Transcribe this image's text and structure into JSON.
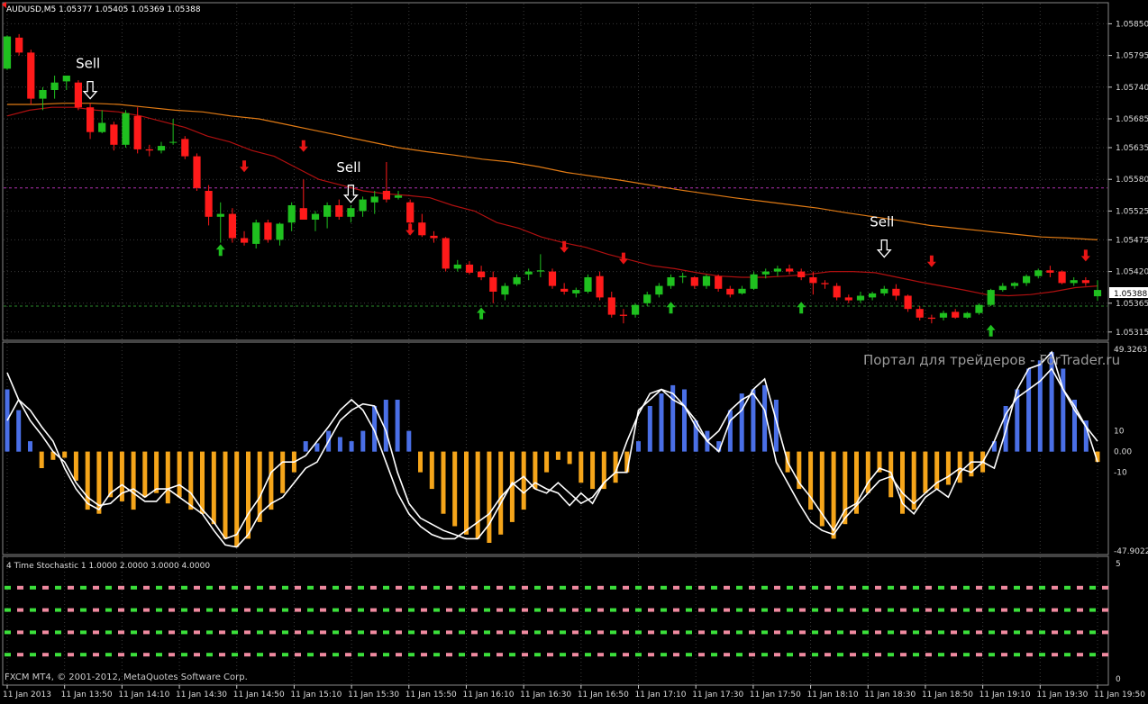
{
  "title": "AUDUSD,M5  1.05377 1.05405 1.05369 1.05388",
  "footer": "FXCM MT4, © 2001-2012, MetaQuotes Software Corp.",
  "watermark": "Портал для трейдеров - ForTrader.ru",
  "current_price_label": "1.05388",
  "signal_label": "Sell",
  "colors": {
    "background": "#000000",
    "grid": "#3a3a3a",
    "bull": "#1fc01f",
    "bear": "#ff1a1a",
    "ma_fast": "#b01010",
    "ma_slow": "#e07a14",
    "hist_pos": "#4a6fe6",
    "hist_neg": "#f5a51a",
    "osc_line": "#ffffff",
    "up_arrow": "#1fc01f",
    "down_arrow": "#e81515",
    "level_magenta": "#b030b0",
    "level_green": "#2a8a2a",
    "stoch_green": "#3be03b",
    "stoch_pink": "#f08aa0"
  },
  "x_labels": [
    "11 Jan 2013",
    "11 Jan 13:50",
    "11 Jan 14:10",
    "11 Jan 14:30",
    "11 Jan 14:50",
    "11 Jan 15:10",
    "11 Jan 15:30",
    "11 Jan 15:50",
    "11 Jan 16:10",
    "11 Jan 16:30",
    "11 Jan 16:50",
    "11 Jan 17:10",
    "11 Jan 17:30",
    "11 Jan 17:50",
    "11 Jan 18:10",
    "11 Jan 18:30",
    "11 Jan 18:50",
    "11 Jan 19:10",
    "11 Jan 19:30",
    "11 Jan 19:50"
  ],
  "chart_data": [
    {
      "type": "candlestick",
      "title": "AUDUSD,M5  1.05377 1.05405 1.05369 1.05388",
      "y_ticks": [
        "1.05850",
        "1.05795",
        "1.05740",
        "1.05685",
        "1.05635",
        "1.05580",
        "1.05525",
        "1.05475",
        "1.05420",
        "1.05365",
        "1.05315"
      ],
      "ylim": [
        1.0531,
        1.0586
      ],
      "candles": [
        {
          "o": 1.05772,
          "h": 1.0583,
          "l": 1.0577,
          "c": 1.05828
        },
        {
          "o": 1.05826,
          "h": 1.05832,
          "l": 1.05795,
          "c": 1.058
        },
        {
          "o": 1.058,
          "h": 1.05805,
          "l": 1.0571,
          "c": 1.0572
        },
        {
          "o": 1.0572,
          "h": 1.0574,
          "l": 1.057,
          "c": 1.05735
        },
        {
          "o": 1.05735,
          "h": 1.0576,
          "l": 1.0572,
          "c": 1.05748
        },
        {
          "o": 1.0575,
          "h": 1.0576,
          "l": 1.05735,
          "c": 1.0576
        },
        {
          "o": 1.05748,
          "h": 1.05752,
          "l": 1.057,
          "c": 1.05705
        },
        {
          "o": 1.05705,
          "h": 1.05712,
          "l": 1.0565,
          "c": 1.05662
        },
        {
          "o": 1.05662,
          "h": 1.057,
          "l": 1.0566,
          "c": 1.05678
        },
        {
          "o": 1.05675,
          "h": 1.0568,
          "l": 1.0563,
          "c": 1.0564
        },
        {
          "o": 1.0564,
          "h": 1.057,
          "l": 1.05635,
          "c": 1.05695
        },
        {
          "o": 1.0569,
          "h": 1.05705,
          "l": 1.05625,
          "c": 1.05632
        },
        {
          "o": 1.05632,
          "h": 1.0564,
          "l": 1.0562,
          "c": 1.0563
        },
        {
          "o": 1.0563,
          "h": 1.05645,
          "l": 1.05625,
          "c": 1.05638
        },
        {
          "o": 1.05645,
          "h": 1.05685,
          "l": 1.0564,
          "c": 1.05645
        },
        {
          "o": 1.0565,
          "h": 1.05655,
          "l": 1.05615,
          "c": 1.0562
        },
        {
          "o": 1.0562,
          "h": 1.05625,
          "l": 1.0556,
          "c": 1.05565
        },
        {
          "o": 1.0556,
          "h": 1.0557,
          "l": 1.055,
          "c": 1.05515
        },
        {
          "o": 1.05515,
          "h": 1.0554,
          "l": 1.0547,
          "c": 1.0552
        },
        {
          "o": 1.0552,
          "h": 1.0553,
          "l": 1.0547,
          "c": 1.05478
        },
        {
          "o": 1.05478,
          "h": 1.0549,
          "l": 1.05465,
          "c": 1.0547
        },
        {
          "o": 1.05468,
          "h": 1.0551,
          "l": 1.0546,
          "c": 1.05505
        },
        {
          "o": 1.05505,
          "h": 1.0551,
          "l": 1.0547,
          "c": 1.05475
        },
        {
          "o": 1.05475,
          "h": 1.05505,
          "l": 1.05465,
          "c": 1.05503
        },
        {
          "o": 1.05505,
          "h": 1.0554,
          "l": 1.0549,
          "c": 1.05535
        },
        {
          "o": 1.0553,
          "h": 1.0558,
          "l": 1.0552,
          "c": 1.0551
        },
        {
          "o": 1.0551,
          "h": 1.05525,
          "l": 1.0549,
          "c": 1.0552
        },
        {
          "o": 1.05515,
          "h": 1.0554,
          "l": 1.05495,
          "c": 1.05535
        },
        {
          "o": 1.05535,
          "h": 1.05545,
          "l": 1.0551,
          "c": 1.05515
        },
        {
          "o": 1.05515,
          "h": 1.05535,
          "l": 1.05505,
          "c": 1.0553
        },
        {
          "o": 1.05525,
          "h": 1.0555,
          "l": 1.05515,
          "c": 1.05545
        },
        {
          "o": 1.0554,
          "h": 1.0556,
          "l": 1.0552,
          "c": 1.0555
        },
        {
          "o": 1.0556,
          "h": 1.0561,
          "l": 1.0554,
          "c": 1.05545
        },
        {
          "o": 1.05548,
          "h": 1.0556,
          "l": 1.05545,
          "c": 1.05552
        },
        {
          "o": 1.0554,
          "h": 1.05545,
          "l": 1.055,
          "c": 1.05505
        },
        {
          "o": 1.05505,
          "h": 1.0552,
          "l": 1.0548,
          "c": 1.05483
        },
        {
          "o": 1.05482,
          "h": 1.0549,
          "l": 1.0547,
          "c": 1.05478
        },
        {
          "o": 1.05478,
          "h": 1.0548,
          "l": 1.0542,
          "c": 1.05425
        },
        {
          "o": 1.05425,
          "h": 1.0544,
          "l": 1.0542,
          "c": 1.05432
        },
        {
          "o": 1.05432,
          "h": 1.05438,
          "l": 1.05415,
          "c": 1.05418
        },
        {
          "o": 1.0542,
          "h": 1.0543,
          "l": 1.05405,
          "c": 1.0541
        },
        {
          "o": 1.0541,
          "h": 1.0542,
          "l": 1.05365,
          "c": 1.05385
        },
        {
          "o": 1.0538,
          "h": 1.054,
          "l": 1.0537,
          "c": 1.05395
        },
        {
          "o": 1.05398,
          "h": 1.05415,
          "l": 1.05395,
          "c": 1.0541
        },
        {
          "o": 1.05415,
          "h": 1.05425,
          "l": 1.05405,
          "c": 1.0542
        },
        {
          "o": 1.0542,
          "h": 1.0545,
          "l": 1.0541,
          "c": 1.05422
        },
        {
          "o": 1.0542,
          "h": 1.05425,
          "l": 1.0539,
          "c": 1.05395
        },
        {
          "o": 1.0539,
          "h": 1.054,
          "l": 1.0538,
          "c": 1.05385
        },
        {
          "o": 1.05382,
          "h": 1.05392,
          "l": 1.05375,
          "c": 1.05388
        },
        {
          "o": 1.05385,
          "h": 1.05415,
          "l": 1.05382,
          "c": 1.0541
        },
        {
          "o": 1.05412,
          "h": 1.0542,
          "l": 1.0537,
          "c": 1.05375
        },
        {
          "o": 1.05375,
          "h": 1.05385,
          "l": 1.0534,
          "c": 1.05345
        },
        {
          "o": 1.05345,
          "h": 1.05355,
          "l": 1.0533,
          "c": 1.05343
        },
        {
          "o": 1.05345,
          "h": 1.05365,
          "l": 1.0534,
          "c": 1.05362
        },
        {
          "o": 1.05365,
          "h": 1.05385,
          "l": 1.0536,
          "c": 1.0538
        },
        {
          "o": 1.0538,
          "h": 1.054,
          "l": 1.05375,
          "c": 1.05395
        },
        {
          "o": 1.05395,
          "h": 1.05415,
          "l": 1.0539,
          "c": 1.0541
        },
        {
          "o": 1.0541,
          "h": 1.05418,
          "l": 1.054,
          "c": 1.05412
        },
        {
          "o": 1.0541,
          "h": 1.05412,
          "l": 1.0539,
          "c": 1.05395
        },
        {
          "o": 1.05395,
          "h": 1.05415,
          "l": 1.0539,
          "c": 1.05412
        },
        {
          "o": 1.05412,
          "h": 1.05415,
          "l": 1.05385,
          "c": 1.0539
        },
        {
          "o": 1.0539,
          "h": 1.05395,
          "l": 1.05375,
          "c": 1.0538
        },
        {
          "o": 1.05382,
          "h": 1.05395,
          "l": 1.0538,
          "c": 1.0539
        },
        {
          "o": 1.0539,
          "h": 1.0542,
          "l": 1.05388,
          "c": 1.05415
        },
        {
          "o": 1.05415,
          "h": 1.05425,
          "l": 1.05408,
          "c": 1.0542
        },
        {
          "o": 1.0542,
          "h": 1.0543,
          "l": 1.05412,
          "c": 1.05425
        },
        {
          "o": 1.05425,
          "h": 1.05432,
          "l": 1.05415,
          "c": 1.0542
        },
        {
          "o": 1.0542,
          "h": 1.05425,
          "l": 1.05405,
          "c": 1.0541
        },
        {
          "o": 1.0541,
          "h": 1.0542,
          "l": 1.0538,
          "c": 1.054
        },
        {
          "o": 1.054,
          "h": 1.05405,
          "l": 1.0539,
          "c": 1.05398
        },
        {
          "o": 1.05395,
          "h": 1.054,
          "l": 1.0537,
          "c": 1.05375
        },
        {
          "o": 1.05375,
          "h": 1.0538,
          "l": 1.05365,
          "c": 1.0537
        },
        {
          "o": 1.0537,
          "h": 1.05385,
          "l": 1.05365,
          "c": 1.05378
        },
        {
          "o": 1.05375,
          "h": 1.05385,
          "l": 1.0537,
          "c": 1.05382
        },
        {
          "o": 1.05382,
          "h": 1.05395,
          "l": 1.05378,
          "c": 1.0539
        },
        {
          "o": 1.0539,
          "h": 1.05398,
          "l": 1.0537,
          "c": 1.05378
        },
        {
          "o": 1.05378,
          "h": 1.0538,
          "l": 1.0535,
          "c": 1.05355
        },
        {
          "o": 1.05355,
          "h": 1.0536,
          "l": 1.05335,
          "c": 1.0534
        },
        {
          "o": 1.0534,
          "h": 1.05345,
          "l": 1.0533,
          "c": 1.05338
        },
        {
          "o": 1.0534,
          "h": 1.05352,
          "l": 1.05335,
          "c": 1.05348
        },
        {
          "o": 1.0535,
          "h": 1.05355,
          "l": 1.05338,
          "c": 1.0534
        },
        {
          "o": 1.0534,
          "h": 1.0535,
          "l": 1.05338,
          "c": 1.05348
        },
        {
          "o": 1.05348,
          "h": 1.05365,
          "l": 1.05345,
          "c": 1.05362
        },
        {
          "o": 1.05362,
          "h": 1.0539,
          "l": 1.0536,
          "c": 1.05388
        },
        {
          "o": 1.05388,
          "h": 1.054,
          "l": 1.05385,
          "c": 1.05395
        },
        {
          "o": 1.05395,
          "h": 1.05402,
          "l": 1.0539,
          "c": 1.054
        },
        {
          "o": 1.054,
          "h": 1.05415,
          "l": 1.05395,
          "c": 1.05412
        },
        {
          "o": 1.05412,
          "h": 1.05425,
          "l": 1.05408,
          "c": 1.05422
        },
        {
          "o": 1.05422,
          "h": 1.0543,
          "l": 1.0541,
          "c": 1.05418
        },
        {
          "o": 1.0542,
          "h": 1.05422,
          "l": 1.05398,
          "c": 1.054
        },
        {
          "o": 1.054,
          "h": 1.0541,
          "l": 1.05395,
          "c": 1.05405
        },
        {
          "o": 1.05405,
          "h": 1.0541,
          "l": 1.05395,
          "c": 1.054
        },
        {
          "o": 1.05377,
          "h": 1.05405,
          "l": 1.05369,
          "c": 1.05388
        }
      ],
      "ma_fast": [
        1.0569,
        1.057,
        1.05705,
        1.05705,
        1.057,
        1.05697,
        1.0569,
        1.0568,
        1.0567,
        1.05655,
        1.05645,
        1.0563,
        1.0562,
        1.056,
        1.0558,
        1.0557,
        1.0556,
        1.05555,
        1.05552,
        1.05548,
        1.05535,
        1.05525,
        1.05505,
        1.05495,
        1.0548,
        1.0547,
        1.05462,
        1.0545,
        1.0544,
        1.0543,
        1.05425,
        1.05418,
        1.05412,
        1.0541,
        1.0541,
        1.05412,
        1.05415,
        1.0542,
        1.0542,
        1.05418,
        1.0541,
        1.05402,
        1.05395,
        1.05388,
        1.0538,
        1.05378,
        1.0538,
        1.05385,
        1.05392,
        1.05395
      ],
      "ma_slow": [
        1.0571,
        1.0571,
        1.05712,
        1.05712,
        1.0571,
        1.05705,
        1.057,
        1.05697,
        1.0569,
        1.05685,
        1.05675,
        1.05665,
        1.05655,
        1.05645,
        1.05635,
        1.05628,
        1.05622,
        1.05615,
        1.0561,
        1.05602,
        1.05592,
        1.05585,
        1.05578,
        1.0557,
        1.05562,
        1.05555,
        1.05548,
        1.05542,
        1.05536,
        1.0553,
        1.05522,
        1.05515,
        1.05508,
        1.055,
        1.05495,
        1.0549,
        1.05485,
        1.0548,
        1.05478,
        1.05475
      ],
      "levels": [
        1.05565,
        1.0536
      ],
      "up_signals": [
        {
          "i": 18,
          "price": 1.05455
        },
        {
          "i": 40,
          "price": 1.05345
        },
        {
          "i": 56,
          "price": 1.05355
        },
        {
          "i": 67,
          "price": 1.05355
        },
        {
          "i": 83,
          "price": 1.05315
        }
      ],
      "down_signals": [
        {
          "i": 20,
          "price": 1.05605
        },
        {
          "i": 25,
          "price": 1.0564
        },
        {
          "i": 34,
          "price": 1.05495
        },
        {
          "i": 47,
          "price": 1.05465
        },
        {
          "i": 52,
          "price": 1.05445
        },
        {
          "i": 78,
          "price": 1.0544
        },
        {
          "i": 91,
          "price": 1.0545
        }
      ],
      "sell_signals": [
        {
          "i": 7,
          "price": 1.0572
        },
        {
          "i": 29,
          "price": 1.0554
        },
        {
          "i": 74,
          "price": 1.05445
        }
      ]
    },
    {
      "type": "bar",
      "subtype": "oscillator_histogram_with_lines",
      "y_ticks": [
        "49.3263",
        "10",
        "0.00",
        "-10",
        "-47.9022"
      ],
      "ylim": [
        -47.9022,
        49.3263
      ],
      "histogram": [
        30,
        20,
        5,
        -8,
        -4,
        -3,
        -14,
        -28,
        -30,
        -22,
        -24,
        -28,
        -22,
        -20,
        -25,
        -22,
        -28,
        -30,
        -35,
        -42,
        -46,
        -42,
        -34,
        -28,
        -20,
        -10,
        5,
        4,
        10,
        7,
        5,
        10,
        22,
        25,
        25,
        10,
        -10,
        -18,
        -30,
        -36,
        -40,
        -42,
        -44,
        -40,
        -34,
        -28,
        -18,
        -10,
        -4,
        -6,
        -15,
        -18,
        -18,
        -15,
        -10,
        5,
        22,
        28,
        32,
        30,
        15,
        10,
        5,
        20,
        28,
        30,
        32,
        25,
        -10,
        -18,
        -28,
        -36,
        -42,
        -35,
        -30,
        -20,
        -10,
        -22,
        -30,
        -28,
        -20,
        -18,
        -16,
        -15,
        -12,
        -10,
        5,
        22,
        30,
        40,
        44,
        48,
        40,
        25,
        15,
        -5
      ],
      "line_a": [
        38,
        25,
        15,
        8,
        0,
        -5,
        -15,
        -22,
        -26,
        -25,
        -20,
        -18,
        -22,
        -18,
        -18,
        -22,
        -26,
        -30,
        -38,
        -45,
        -46,
        -40,
        -30,
        -25,
        -22,
        -15,
        -8,
        -5,
        5,
        15,
        20,
        23,
        22,
        10,
        -10,
        -25,
        -32,
        -35,
        -38,
        -40,
        -42,
        -42,
        -35,
        -25,
        -15,
        -20,
        -15,
        -18,
        -20,
        -26,
        -20,
        -25,
        -15,
        -10,
        -10,
        20,
        25,
        30,
        28,
        22,
        12,
        5,
        0,
        15,
        20,
        30,
        35,
        15,
        -5,
        -15,
        -22,
        -30,
        -38,
        -28,
        -25,
        -15,
        -8,
        -10,
        -25,
        -30,
        -22,
        -18,
        -22,
        -10,
        -5,
        -5,
        -8,
        10,
        30,
        40,
        42,
        48,
        30,
        20,
        12,
        -5
      ],
      "line_b": [
        15,
        25,
        20,
        12,
        5,
        -8,
        -18,
        -25,
        -28,
        -20,
        -16,
        -20,
        -24,
        -24,
        -18,
        -16,
        -20,
        -28,
        -34,
        -42,
        -40,
        -30,
        -22,
        -10,
        -5,
        -5,
        -2,
        5,
        12,
        20,
        25,
        20,
        10,
        -5,
        -20,
        -30,
        -36,
        -40,
        -42,
        -42,
        -38,
        -34,
        -30,
        -22,
        -16,
        -12,
        -18,
        -20,
        -15,
        -20,
        -25,
        -22,
        -15,
        -10,
        5,
        18,
        28,
        30,
        25,
        22,
        15,
        5,
        10,
        20,
        25,
        28,
        20,
        -5,
        -15,
        -25,
        -34,
        -38,
        -40,
        -32,
        -26,
        -20,
        -14,
        -12,
        -20,
        -25,
        -20,
        -15,
        -12,
        -8,
        -10,
        -5,
        5,
        18,
        26,
        30,
        34,
        40,
        30,
        22,
        12,
        5
      ]
    },
    {
      "type": "scatter",
      "subtype": "dotted_levels",
      "title": "4 Time Stochastic 1 1.0000 2.0000 3.0000 4.0000",
      "y_ticks": [
        "5",
        "0"
      ],
      "ylim": [
        0,
        5
      ],
      "series": [
        {
          "value": 4
        },
        {
          "value": 3
        },
        {
          "value": 2
        },
        {
          "value": 1
        }
      ]
    }
  ]
}
